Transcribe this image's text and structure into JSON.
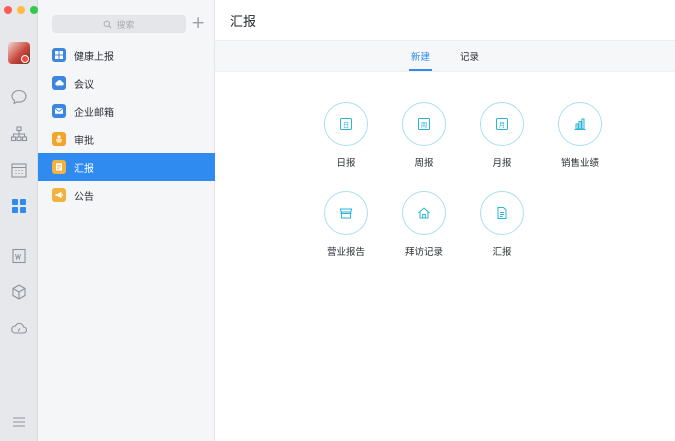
{
  "colors": {
    "accent": "#2f8bef",
    "tile_ring": "#a9dff0",
    "tile_icon": "#2ab4d8",
    "health_icon": "#3d86e0",
    "meeting_icon": "#3d86e0",
    "mail_icon": "#3d86e0",
    "approval_icon": "#f3a42b",
    "report_icon": "#f3b23c",
    "notice_icon": "#f3b23c"
  },
  "rail": {
    "icons": [
      "chat-icon",
      "org-chart-icon",
      "calendar-icon",
      "workbench-icon",
      "word-doc-icon",
      "box-icon",
      "cloud-icon",
      "menu-icon"
    ]
  },
  "sidebar": {
    "search_placeholder": "搜索",
    "add_symbol": "+",
    "items": [
      {
        "label": "健康上报",
        "icon": "grid-icon"
      },
      {
        "label": "会议",
        "icon": "meeting-icon"
      },
      {
        "label": "企业邮箱",
        "icon": "mail-icon"
      },
      {
        "label": "审批",
        "icon": "approval-icon"
      },
      {
        "label": "汇报",
        "icon": "report-icon",
        "active": true
      },
      {
        "label": "公告",
        "icon": "megaphone-icon"
      }
    ]
  },
  "main": {
    "title": "汇报",
    "tabs": [
      {
        "label": "新建",
        "active": true
      },
      {
        "label": "记录",
        "active": false
      }
    ],
    "tiles": [
      {
        "label": "日报",
        "icon": "day-calendar-icon",
        "glyph": "日"
      },
      {
        "label": "周报",
        "icon": "week-calendar-icon",
        "glyph": "周"
      },
      {
        "label": "月报",
        "icon": "month-calendar-icon",
        "glyph": "月"
      },
      {
        "label": "销售业绩",
        "icon": "bar-chart-icon",
        "glyph": ""
      },
      {
        "label": "营业报告",
        "icon": "store-icon",
        "glyph": ""
      },
      {
        "label": "拜访记录",
        "icon": "house-icon",
        "glyph": ""
      },
      {
        "label": "汇报",
        "icon": "document-icon",
        "glyph": ""
      }
    ]
  }
}
